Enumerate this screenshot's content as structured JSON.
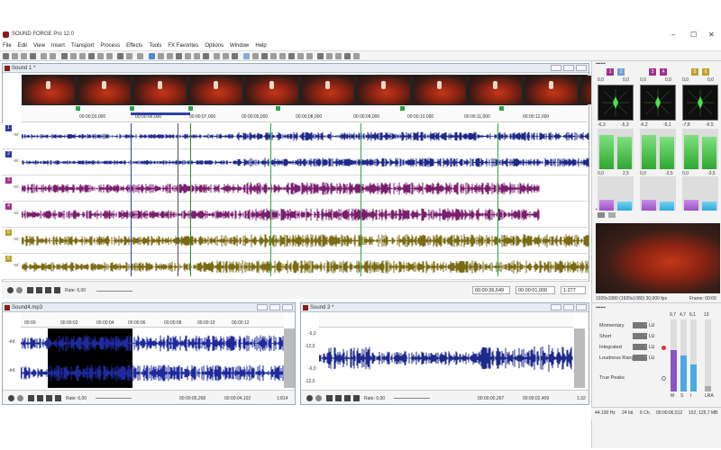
{
  "app": {
    "title": "SOUND FORGE Pro 12.0"
  },
  "menu": [
    "File",
    "Edit",
    "View",
    "Insert",
    "Transport",
    "Process",
    "Effects",
    "Tools",
    "FX Favorites",
    "Options",
    "Window",
    "Help"
  ],
  "main_window": {
    "title": "Sound 1 *",
    "ruler_labels": [
      "00:00:03,000",
      "00:00:06,000",
      "00:00:07,000",
      "00:00:05,000",
      "00:00:08,000",
      "00:00:09,000",
      "00:00:10,000",
      "00:00:11,000",
      "00:00:12,000"
    ],
    "channels": [
      {
        "num": "1",
        "color": "#2a3ca0",
        "wave": "#1e2a8a",
        "db": "-Inf."
      },
      {
        "num": "2",
        "color": "#2a3ca0",
        "wave": "#1e2a8a",
        "db": "-Inf."
      },
      {
        "num": "3",
        "color": "#a0308f",
        "wave": "#7a1f6e",
        "db": "-Inf."
      },
      {
        "num": "4",
        "color": "#a0308f",
        "wave": "#7a1f6e",
        "db": "-Inf."
      },
      {
        "num": "5",
        "color": "#bda12a",
        "wave": "#7a6b14",
        "db": "-Inf."
      },
      {
        "num": "6",
        "color": "#bda12a",
        "wave": "#7a6b14",
        "db": "-Inf."
      }
    ],
    "rate": "Rate: 6,00",
    "time1": "00:00:36,649",
    "time2": "00:00:01,000",
    "zoom": "1:277"
  },
  "right_panel": {
    "meter_pairs": [
      {
        "a": "1",
        "b": "2",
        "top": "0,0",
        "top2": "0,0",
        "mid1": "-6,3",
        "mid2": "-5,3",
        "lo1": "0,0",
        "lo2": "2,5",
        "ca": "#a0308f",
        "cb": "#6a9fd8"
      },
      {
        "a": "3",
        "b": "4",
        "top": "0,0",
        "top2": "0,0",
        "mid1": "-6,2",
        "mid2": "-5,1",
        "lo1": "0,0",
        "lo2": "-3,5",
        "ca": "#a0308f",
        "cb": "#a0308f"
      },
      {
        "a": "5",
        "b": "6",
        "top": "0,0",
        "top2": "0,0",
        "mid1": "-7,8",
        "mid2": "-6,5",
        "lo1": "0,0",
        "lo2": "-3,5",
        "ca": "#bda12a",
        "cb": "#bda12a"
      }
    ],
    "video_info": "1920x1080 (1920x1080) 30,000 fps",
    "frame": "Frame: 00:00"
  },
  "bottom1": {
    "title": "Sound4.mp3",
    "ruler": [
      "00:00",
      "00:00:02",
      "00:00:04",
      "00:00:06",
      "00:00:08",
      "00:00:10",
      "00:00:12"
    ],
    "db": [
      "-Inf.",
      "-Inf."
    ],
    "rate": "Rate: 6,00",
    "time1": "00:00:05,268",
    "time2": "00:00:04,102",
    "zoom": "1:814"
  },
  "bottom2": {
    "title": "Sound 3 *",
    "db_scale": [
      "-6,0",
      "-12,0",
      "-6,0",
      "-12,0"
    ],
    "rate": "Rate: 0,00",
    "time1": "00:00:00,267",
    "time2": "00:00:02,409",
    "zoom": "1:32"
  },
  "loudness": {
    "rows": [
      {
        "label": "Momentary",
        "value": "-",
        "unit": "LU"
      },
      {
        "label": "Short",
        "value": "-",
        "unit": "LU"
      },
      {
        "label": "Integrated",
        "value": "-",
        "unit": "LU"
      },
      {
        "label": "Loudness Range",
        "value": "-",
        "unit": "LU"
      }
    ],
    "true_peaks": "True Peaks",
    "scale": [
      "9,7",
      "4,7",
      "6,1",
      "13"
    ],
    "labels": [
      "M",
      "S",
      "I",
      "LRA"
    ]
  },
  "status": [
    "44.100 Hz",
    "24 bit",
    "6 Ch.",
    "00:00:06,512",
    "152, 125,7 MB"
  ]
}
